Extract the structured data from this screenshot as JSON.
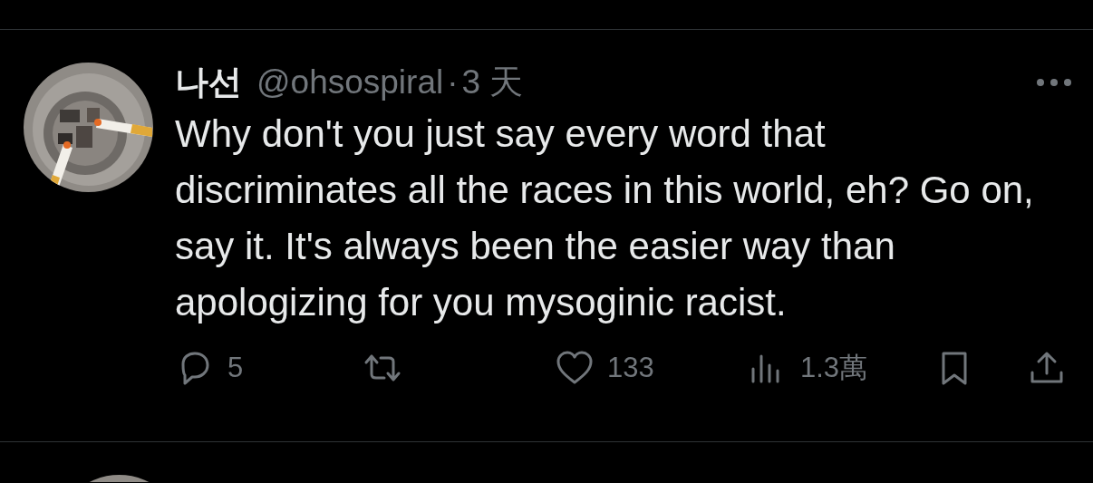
{
  "tweet": {
    "display_name": "나선",
    "handle": "@ohsospiral",
    "separator": "·",
    "time": "3 天",
    "text": "Why don't you just say every word that discriminates all the races in this world, eh? Go on, say it. It's always been the easier way than apologizing for you mysoginic racist.",
    "actions": [
      {
        "kind": "reply",
        "count": "5"
      },
      {
        "kind": "retweet"
      },
      {
        "kind": "like",
        "count": "133"
      },
      {
        "kind": "views",
        "count": "1.3萬"
      },
      {
        "kind": "bookmark"
      },
      {
        "kind": "share"
      }
    ]
  }
}
